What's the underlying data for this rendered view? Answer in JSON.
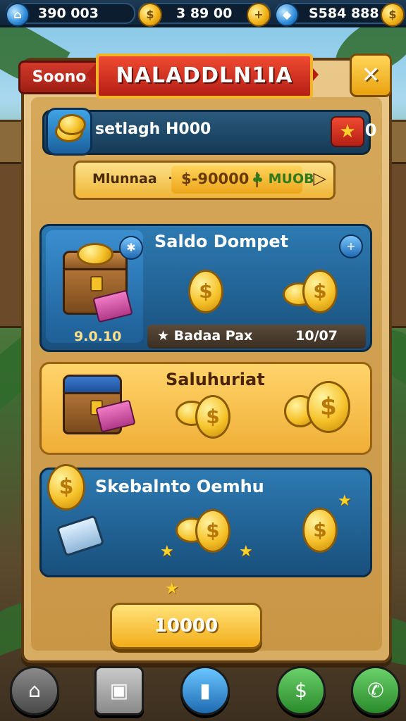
{
  "topbar": {
    "resource1": {
      "icon": "home-icon",
      "value": "390 003"
    },
    "resource2": {
      "icon": "gold-coin-icon",
      "value": "3 89 00"
    },
    "resource3": {
      "icon": "blue-gem-icon",
      "value": "S584 888"
    }
  },
  "header": {
    "tab_label": "Soono",
    "title": "NALADDLN1IA",
    "close_symbol": "✕"
  },
  "search_row": {
    "label": "setlagh H000",
    "count": "10",
    "star_symbol": "★"
  },
  "filter_row": {
    "label": "Mlunnaa",
    "separator": "-",
    "amount": "$-90000 |",
    "tag": "♣ MUOB",
    "arrow": "▷"
  },
  "cards": [
    {
      "title": "Saldo Dompet",
      "left_value": "9.0.10",
      "bar_label": "★ Badaa Pax",
      "bar_value": "10/07"
    },
    {
      "title": "Saluhuriat"
    },
    {
      "title": "Skebalnto Oemhu"
    }
  ],
  "claim_button": {
    "label": "10000"
  },
  "coin_symbol": "$",
  "colors": {
    "accent_red": "#d23a2a",
    "accent_gold": "#f2b418",
    "card_blue": "#2d7ab2"
  },
  "bottom_nav": [
    {
      "icon": "home-nav-icon"
    },
    {
      "icon": "bag-icon"
    },
    {
      "icon": "card-icon"
    },
    {
      "icon": "treasure-icon"
    },
    {
      "icon": "phone-icon"
    }
  ]
}
